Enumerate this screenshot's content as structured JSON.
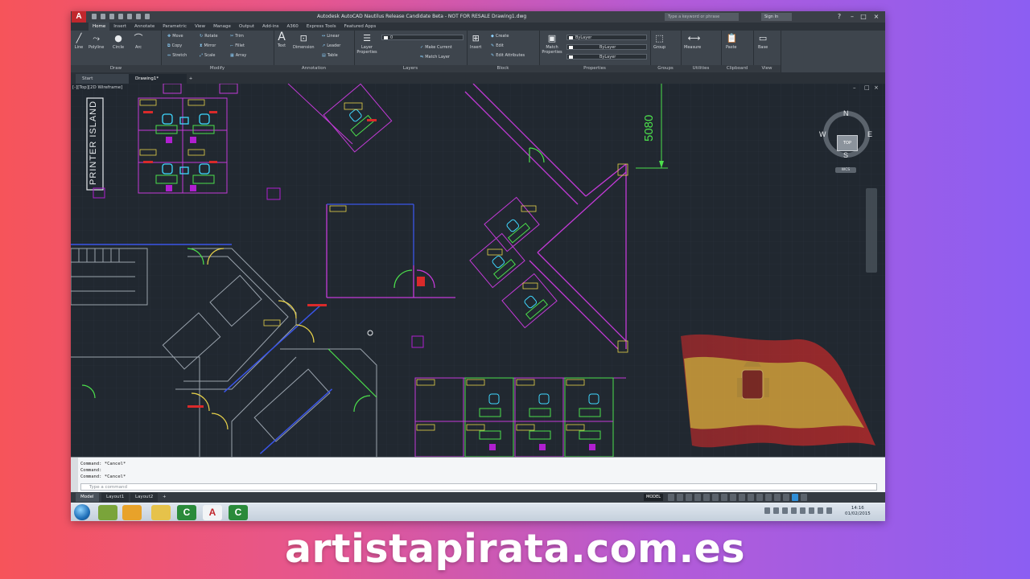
{
  "app": {
    "logo_letter": "A",
    "window_title": "Autodesk AutoCAD Nautilus Release Candidate Beta - NOT FOR RESALE   Drawing1.dwg",
    "search_placeholder": "Type a keyword or phrase",
    "user_label": "Sign In"
  },
  "ribbon_tabs": [
    {
      "label": "Home",
      "active": true
    },
    {
      "label": "Insert"
    },
    {
      "label": "Annotate"
    },
    {
      "label": "Parametric"
    },
    {
      "label": "View"
    },
    {
      "label": "Manage"
    },
    {
      "label": "Output"
    },
    {
      "label": "Add-ins"
    },
    {
      "label": "A360"
    },
    {
      "label": "Express Tools"
    },
    {
      "label": "Featured Apps"
    }
  ],
  "ribbon": {
    "draw": {
      "label": "Draw",
      "line": "Line",
      "polyline": "Polyline",
      "circle": "Circle",
      "arc": "Arc"
    },
    "modify": {
      "label": "Modify",
      "move": "Move",
      "rotate": "Rotate",
      "trim": "Trim",
      "copy": "Copy",
      "mirror": "Mirror",
      "fillet": "Fillet",
      "stretch": "Stretch",
      "scale": "Scale",
      "array": "Array"
    },
    "annotation": {
      "label": "Annotation",
      "text": "Text",
      "dimension": "Dimension",
      "linear": "Linear",
      "leader": "Leader",
      "table": "Table"
    },
    "layers": {
      "label": "Layers",
      "properties": "Layer Properties",
      "make_current": "Make Current",
      "match_layer": "Match Layer",
      "current_layer": "0"
    },
    "block": {
      "label": "Block",
      "insert": "Insert",
      "create": "Create",
      "edit": "Edit",
      "edit_attributes": "Edit Attributes"
    },
    "properties": {
      "label": "Properties",
      "match": "Match Properties",
      "color": "ByLayer",
      "linetype": "ByLayer",
      "lineweight": "ByLayer"
    },
    "groups": {
      "label": "Groups",
      "group": "Group"
    },
    "utilities": {
      "label": "Utilities",
      "measure": "Measure"
    },
    "clipboard": {
      "label": "Clipboard",
      "paste": "Paste"
    },
    "view": {
      "label": "View",
      "base": "Base"
    }
  },
  "file_tabs": [
    {
      "label": "Start"
    },
    {
      "label": "Drawing1*",
      "active": true
    }
  ],
  "viewport": {
    "label": "[-][Top][2D Wireframe]",
    "dimension_value": "5080",
    "printer_island": "PRINTER ISLAND",
    "compass": {
      "n": "N",
      "s": "S",
      "e": "E",
      "w": "W",
      "top": "TOP"
    },
    "wcs": "WCS"
  },
  "command": {
    "history": [
      "Command: *Cancel*",
      "Command:",
      "Command: *Cancel*"
    ],
    "placeholder": "Type a command"
  },
  "layout_tabs": [
    {
      "label": "Model",
      "active": true
    },
    {
      "label": "Layout1"
    },
    {
      "label": "Layout2"
    }
  ],
  "status": {
    "model": "MODEL"
  },
  "taskbar": {
    "time": "14:16",
    "date": "01/02/2015"
  },
  "watermark": "artistapirata.com.es"
}
